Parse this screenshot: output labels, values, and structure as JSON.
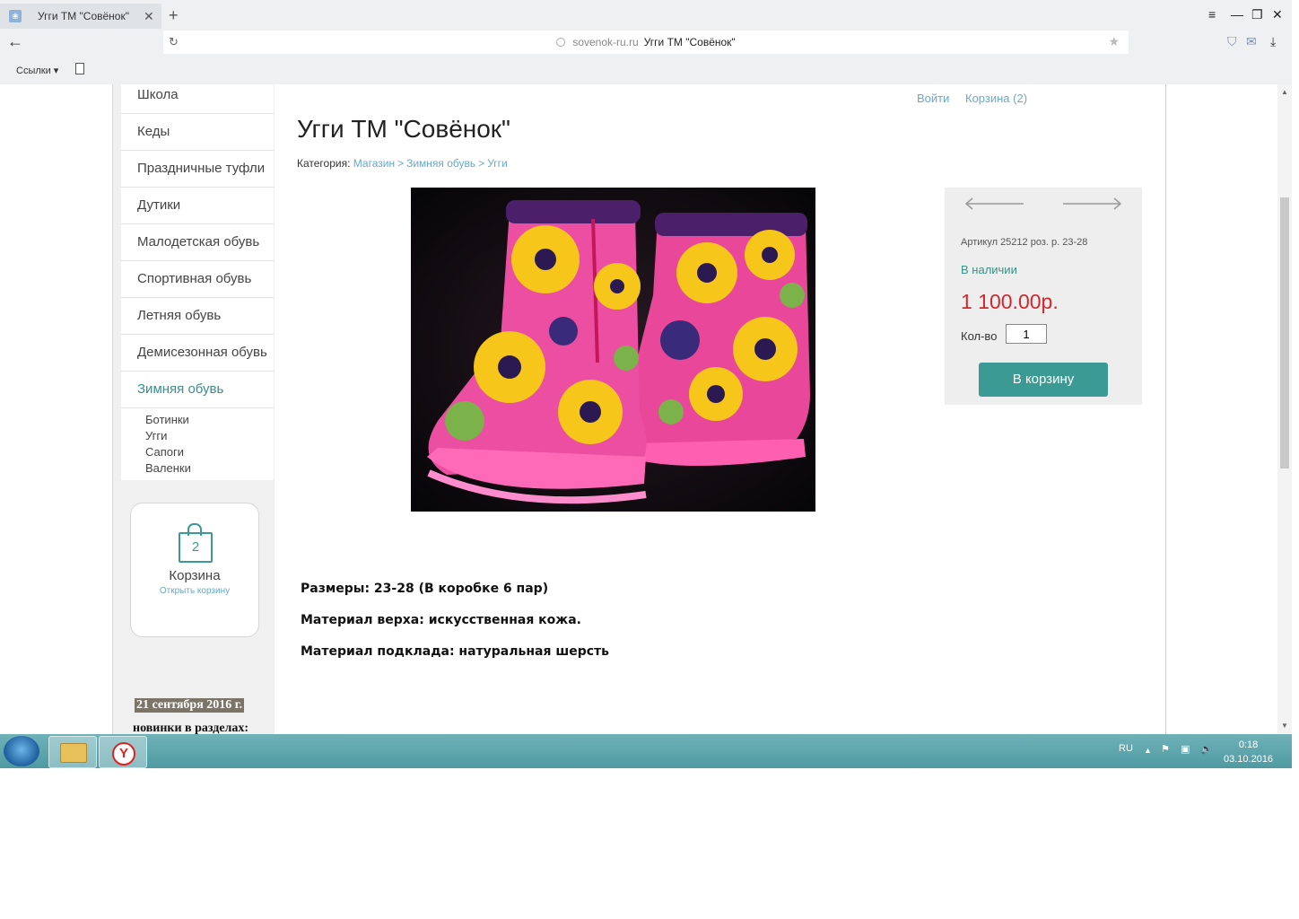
{
  "browser": {
    "tab_title": "Угги ТМ \"Совёнок\"",
    "tab_close": "✕",
    "new_tab": "+",
    "url_host": "sovenok-ru.ru",
    "url_title": "Угги ТМ \"Совёнок\"",
    "bookmarks_label": "Ссылки ▾",
    "menu_icon": "≡",
    "minimize_icon": "—",
    "restore_icon": "❐",
    "close_icon": "✕",
    "back_icon": "←",
    "reload_icon": "↻",
    "star_icon": "★",
    "download_icon": "⤓"
  },
  "header": {
    "login": "Войти",
    "cart": "Корзина (2)"
  },
  "sidebar": {
    "items": [
      {
        "label": "Школа"
      },
      {
        "label": "Кеды"
      },
      {
        "label": "Праздничные туфли"
      },
      {
        "label": "Дутики"
      },
      {
        "label": "Малодетская обувь"
      },
      {
        "label": "Спортивная обувь"
      },
      {
        "label": "Летняя обувь"
      },
      {
        "label": "Демисезонная обувь"
      },
      {
        "label": "Зимняя обувь",
        "active": true
      }
    ],
    "subitems": [
      {
        "label": "Ботинки"
      },
      {
        "label": "Угги"
      },
      {
        "label": "Сапоги"
      },
      {
        "label": "Валенки"
      }
    ]
  },
  "cart_widget": {
    "count": "2",
    "title": "Корзина",
    "link": "Открыть корзину"
  },
  "news": {
    "date": "21 сентября 2016 г.",
    "text": "новинки в разделах:"
  },
  "product": {
    "title": "Угги ТМ \"Совёнок\"",
    "category_label": "Категория:",
    "breadcrumbs": [
      "Магазин",
      "Зимняя обувь",
      "Угги"
    ],
    "crumb_separator": ">",
    "sku": "Артикул 25212 роз. р. 23-28",
    "availability": "В наличии",
    "price": "1 100.00р.",
    "qty_label": "Кол-во",
    "qty_value": "1",
    "add_to_cart": "В корзину",
    "description": [
      "Размеры: 23-28 (В коробке 6 пар)",
      "Материал верха: искусственная кожа.",
      "Материал подклада: натуральная шерсть"
    ]
  },
  "taskbar": {
    "lang": "RU",
    "time": "0:18",
    "date": "03.10.2016",
    "yandex_letter": "Y"
  },
  "colors": {
    "accent": "#3b9a94",
    "link": "#6aa8c7",
    "price": "#d0282e",
    "taskbar": "#5aa3aa"
  }
}
